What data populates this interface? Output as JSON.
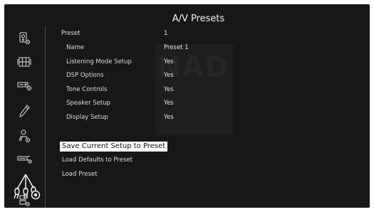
{
  "page": {
    "title": "A/V Presets"
  },
  "watermark": {
    "text": "NAD"
  },
  "sidebar": {
    "items": [
      {
        "icon": "speaker-source-icon"
      },
      {
        "icon": "grid-input-icon"
      },
      {
        "icon": "amplifier-icon"
      },
      {
        "icon": "pen-icon"
      },
      {
        "icon": "user-settings-icon"
      },
      {
        "icon": "hdmi-icon"
      },
      {
        "icon": "av-presets-icon",
        "active": true
      },
      {
        "icon": "speaker-settings-icon"
      }
    ]
  },
  "preset": {
    "label": "Preset",
    "value": "1",
    "rows": [
      {
        "label": "Name",
        "value": "Preset 1"
      },
      {
        "label": "Listening Mode Setup",
        "value": "Yes"
      },
      {
        "label": "DSP Options",
        "value": "Yes"
      },
      {
        "label": "Tone Controls",
        "value": "Yes"
      },
      {
        "label": "Speaker Setup",
        "value": "Yes"
      },
      {
        "label": "Display Setup",
        "value": "Yes"
      }
    ]
  },
  "actions": {
    "save": "Save Current Setup to Preset",
    "load_defaults": "Load Defaults to Preset",
    "load": "Load Preset"
  }
}
